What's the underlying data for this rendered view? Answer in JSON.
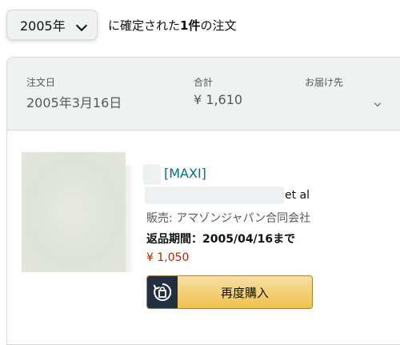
{
  "filter": {
    "year_label": "2005年",
    "count_prefix": "に確定された",
    "count_bold": "1件",
    "count_suffix": "の注文"
  },
  "order": {
    "date_label": "注文日",
    "date_value": "2005年3月16日",
    "total_label": "合計",
    "total_value": "¥ 1,610",
    "ship_to_label": "お届け先"
  },
  "item": {
    "title": "[MAXI]",
    "author_suffix": "et al",
    "seller": "販売: アマゾンジャパン合同会社",
    "return_period": "返品期間：2005/04/16まで",
    "price": "¥ 1,050",
    "rebuy_label": "再度購入"
  },
  "colors": {
    "link": "#007185",
    "price": "#b12704",
    "button": "#f0c14b",
    "button_icon_bg": "#232f3e"
  },
  "icons": {
    "year_dropdown": "chevron-down-icon",
    "ship_to_dropdown": "chevron-down-icon",
    "rebuy": "buy-again-icon"
  }
}
